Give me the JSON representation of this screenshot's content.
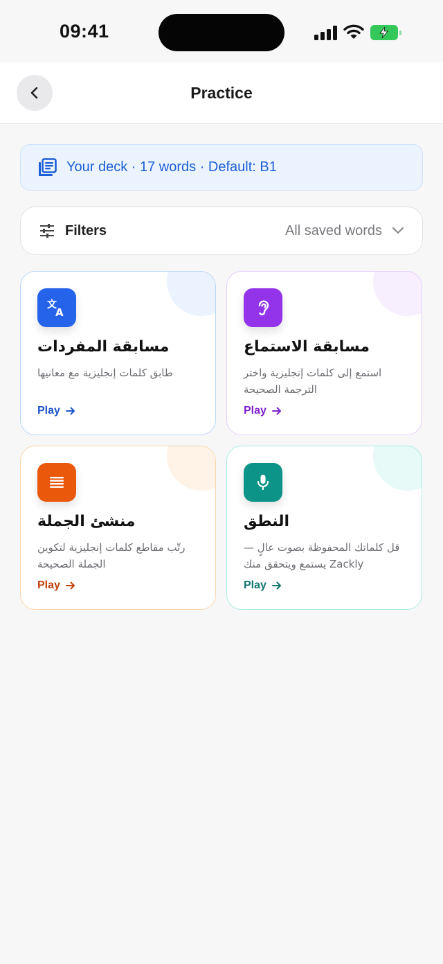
{
  "status_bar": {
    "time": "09:41"
  },
  "header": {
    "title": "Practice",
    "back_icon": "chevron-left-icon"
  },
  "deck": {
    "icon": "library-books-icon",
    "text": "Your deck · 17 words · Default: B1"
  },
  "filters": {
    "icon": "sliders-icon",
    "label": "Filters",
    "selected": "All saved words",
    "chevron_icon": "chevron-down-icon"
  },
  "cards": [
    {
      "icon": "translate-icon",
      "title": "مسابقة المفردات",
      "description": "طابق كلمات إنجليزية مع معانيها",
      "play_label": "Play",
      "accent": "#2563eb"
    },
    {
      "icon": "ear-icon",
      "title": "مسابقة الاستماع",
      "description": "استمع إلى كلمات إنجليزية واختر الترجمة الصحيحة",
      "play_label": "Play",
      "accent": "#9333ea"
    },
    {
      "icon": "list-lines-icon",
      "title": "منشئ الجملة",
      "description": "رتّب مقاطع كلمات إنجليزية لتكوين الجملة الصحيحة",
      "play_label": "Play",
      "accent": "#ea580c"
    },
    {
      "icon": "microphone-icon",
      "title": "النطق",
      "description": "قل كلماتك المحفوظة بصوت عالٍ — Zackly يستمع ويتحقق منك",
      "play_label": "Play",
      "accent": "#0d9488"
    }
  ]
}
